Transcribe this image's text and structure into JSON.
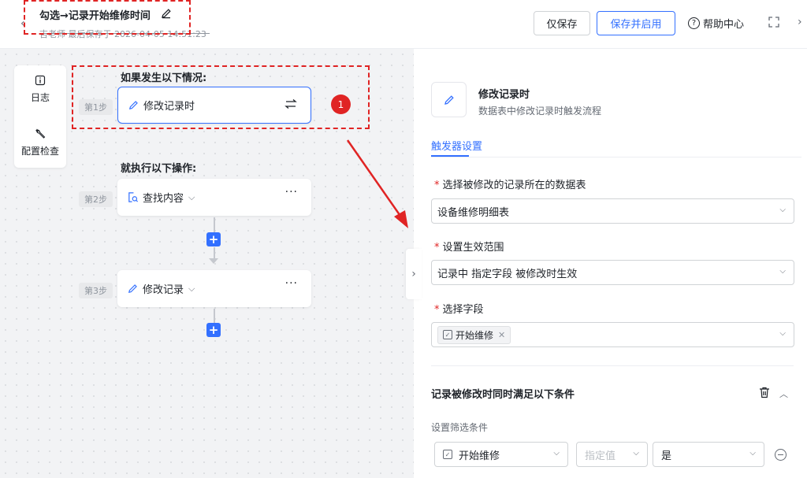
{
  "header": {
    "title": "勾选→记录开始维修时间",
    "subtitle": "吉老师 最后保存于 2026-04-05 14:51:23",
    "save_only": "仅保存",
    "save_enable": "保存并启用",
    "help": "帮助中心"
  },
  "side_tools": {
    "log": "日志",
    "config_check": "配置检查"
  },
  "canvas": {
    "if_label": "如果发生以下情况:",
    "then_label": "就执行以下操作:",
    "badge": "1",
    "steps": [
      {
        "step": "第1步",
        "label": "修改记录时"
      },
      {
        "step": "第2步",
        "label": "查找内容"
      },
      {
        "step": "第3步",
        "label": "修改记录"
      }
    ],
    "plus": "+"
  },
  "panel": {
    "title": "修改记录时",
    "desc": "数据表中修改记录时触发流程",
    "tab": "触发器设置",
    "table_label": "选择被修改的记录所在的数据表",
    "table_value": "设备维修明细表",
    "scope_label": "设置生效范围",
    "scope_value": "记录中 指定字段 被修改时生效",
    "field_label": "选择字段",
    "field_tag": "开始维修",
    "cond_title": "记录被修改时同时满足以下条件",
    "cond_sub": "设置筛选条件",
    "cond_field": "开始维修",
    "cond_op": "指定值",
    "cond_value": "是"
  },
  "colors": {
    "accent": "#3370ff",
    "annotation_red": "#e02424"
  }
}
